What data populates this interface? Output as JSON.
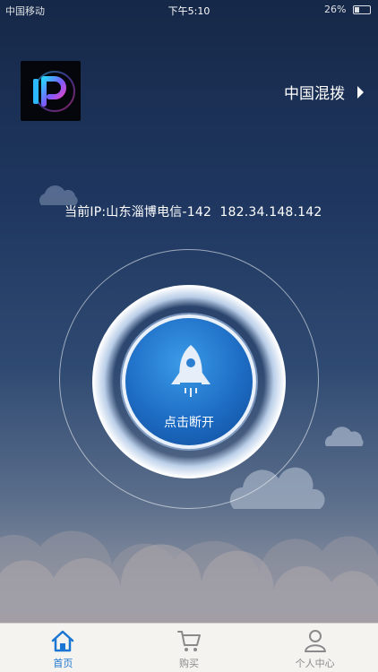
{
  "status_bar": {
    "carrier": "中国移动",
    "time": "下午5:10",
    "battery": "26%"
  },
  "region_selector": {
    "label": "中国混拨"
  },
  "current_ip": {
    "label": "当前IP:山东淄博电信-142",
    "address": "182.34.148.142"
  },
  "connect_button": {
    "label": "点击断开"
  },
  "tabs": [
    {
      "label": "首页",
      "icon": "home-icon",
      "active": true
    },
    {
      "label": "购买",
      "icon": "cart-icon",
      "active": false
    },
    {
      "label": "个人中心",
      "icon": "user-icon",
      "active": false
    }
  ],
  "colors": {
    "accent": "#1a76d2",
    "button": "#1d6cc4"
  }
}
